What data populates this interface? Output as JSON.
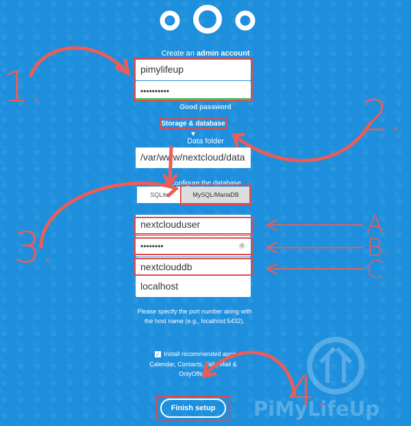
{
  "header": {
    "create_prefix": "Create an ",
    "create_bold": "admin account"
  },
  "admin": {
    "username": "pimylifeup",
    "password_mask": "••••••••••",
    "strength_label": "Good password"
  },
  "storage_toggle_label": "Storage & database ▾",
  "data_folder": {
    "label": "Data folder",
    "value": "/var/www/nextcloud/data"
  },
  "database": {
    "label": "Configure the database",
    "options": [
      "SQLite",
      "MySQL/MariaDB"
    ],
    "selected": "MySQL/MariaDB",
    "user": "nextclouduser",
    "password_mask": "••••••••",
    "name": "nextclouddb",
    "host": "localhost",
    "hint": "Please specify the port number along with the host name (e.g., localhost:5432)."
  },
  "apps": {
    "checkbox_label": "Install recommended apps",
    "list": "Calendar, Contacts, Talk, Mail & OnlyOffice"
  },
  "finish_button": "Finish setup",
  "annotations": {
    "one": "1.",
    "two": "2.",
    "three": "3.",
    "four": "4.",
    "a": "A.",
    "b": "B.",
    "c": "C."
  },
  "watermark": "PiMyLifeUp",
  "colors": {
    "background": "#1d8fdd",
    "accent_red": "#e34848",
    "strength_green": "#46ba61"
  }
}
